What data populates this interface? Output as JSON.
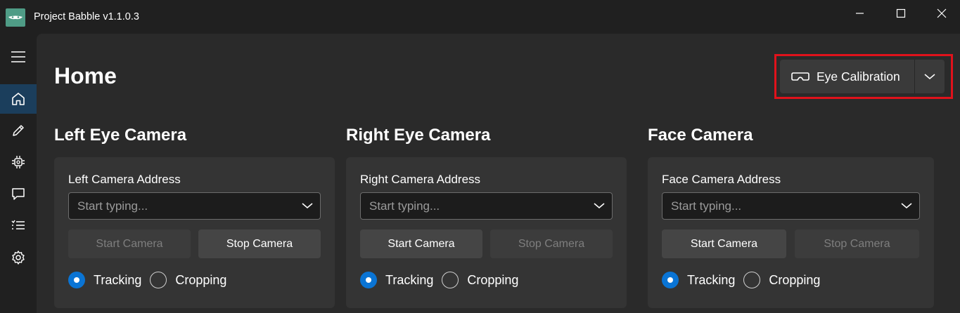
{
  "window": {
    "title": "Project Babble v1.1.0.3",
    "logo_icon": "babble-logo-icon",
    "controls": [
      "minimize-icon",
      "maximize-icon",
      "close-icon"
    ]
  },
  "sidebar": {
    "items": [
      {
        "icon": "hamburger-menu-icon",
        "active": false
      },
      {
        "icon": "home-icon",
        "active": true
      },
      {
        "icon": "pencil-icon",
        "active": false
      },
      {
        "icon": "chip-icon",
        "active": false
      },
      {
        "icon": "chat-icon",
        "active": false
      },
      {
        "icon": "list-icon",
        "active": false
      },
      {
        "icon": "gear-icon",
        "active": false
      }
    ]
  },
  "main": {
    "title": "Home",
    "calibration": {
      "label": "Eye Calibration",
      "icon": "vr-headset-icon",
      "dropdown_icon": "chevron-down-icon",
      "highlight_color": "#e0121b"
    },
    "cameras": [
      {
        "heading": "Left Eye Camera",
        "address_label": "Left Camera Address",
        "address_placeholder": "Start typing...",
        "address_value": "",
        "start_label": "Start Camera",
        "start_enabled": false,
        "stop_label": "Stop Camera",
        "stop_enabled": true,
        "tracking_label": "Tracking",
        "cropping_label": "Cropping",
        "selected_mode": "Tracking"
      },
      {
        "heading": "Right Eye Camera",
        "address_label": "Right Camera Address",
        "address_placeholder": "Start typing...",
        "address_value": "",
        "start_label": "Start Camera",
        "start_enabled": true,
        "stop_label": "Stop Camera",
        "stop_enabled": false,
        "tracking_label": "Tracking",
        "cropping_label": "Cropping",
        "selected_mode": "Tracking"
      },
      {
        "heading": "Face Camera",
        "address_label": "Face Camera Address",
        "address_placeholder": "Start typing...",
        "address_value": "",
        "start_label": "Start Camera",
        "start_enabled": true,
        "stop_label": "Stop Camera",
        "stop_enabled": false,
        "tracking_label": "Tracking",
        "cropping_label": "Cropping",
        "selected_mode": "Tracking"
      }
    ]
  },
  "colors": {
    "accent": "#0a74d4",
    "nav_active": "#0f4f85",
    "logo_bg": "#4f9c86"
  }
}
